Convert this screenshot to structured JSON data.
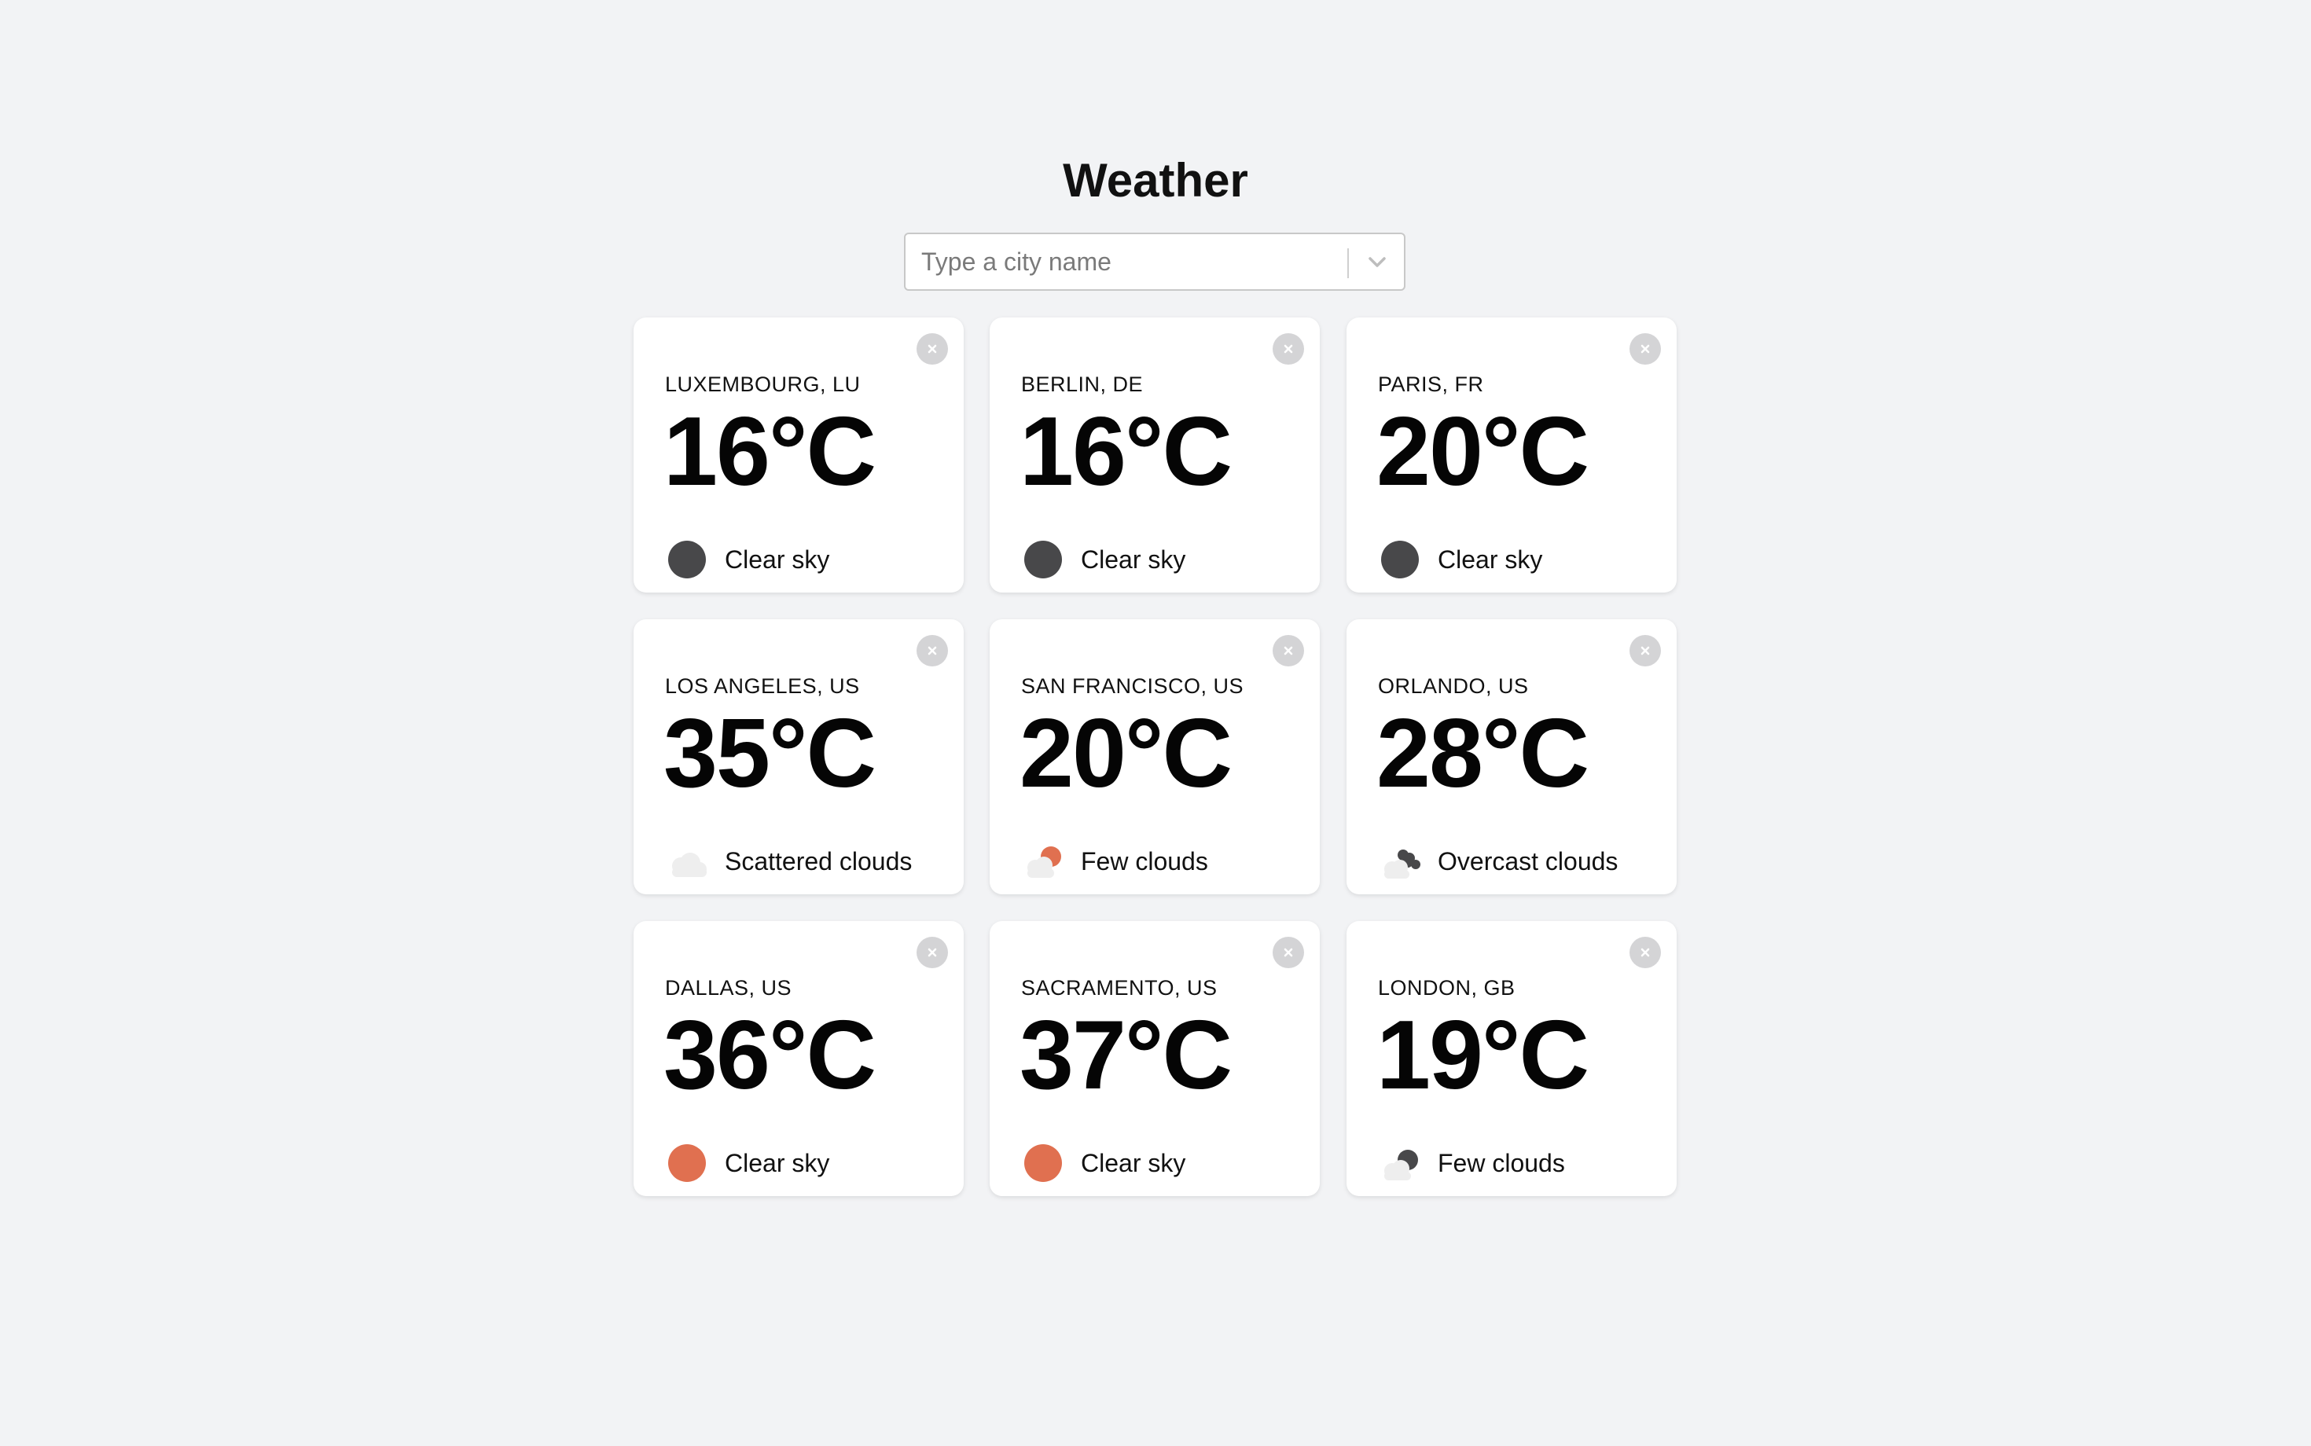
{
  "app": {
    "title": "Weather"
  },
  "search": {
    "placeholder": "Type a city name",
    "value": ""
  },
  "colors": {
    "background": "#f2f3f5",
    "card": "#ffffff",
    "dark_icon": "#48484a",
    "warm_icon": "#e07050",
    "cloud": "#eeeeee",
    "close_button": "#d4d4d6"
  },
  "cards": [
    {
      "city": "LUXEMBOURG, LU",
      "temp": "16°C",
      "condition": "Clear sky",
      "icon": "moon-icon"
    },
    {
      "city": "BERLIN, DE",
      "temp": "16°C",
      "condition": "Clear sky",
      "icon": "moon-icon"
    },
    {
      "city": "PARIS, FR",
      "temp": "20°C",
      "condition": "Clear sky",
      "icon": "moon-icon"
    },
    {
      "city": "LOS ANGELES, US",
      "temp": "35°C",
      "condition": "Scattered clouds",
      "icon": "cloud-icon"
    },
    {
      "city": "SAN FRANCISCO, US",
      "temp": "20°C",
      "condition": "Few clouds",
      "icon": "sun-behind-cloud-icon"
    },
    {
      "city": "ORLANDO, US",
      "temp": "28°C",
      "condition": "Overcast clouds",
      "icon": "overcast-clouds-icon"
    },
    {
      "city": "DALLAS, US",
      "temp": "36°C",
      "condition": "Clear sky",
      "icon": "sun-icon"
    },
    {
      "city": "SACRAMENTO, US",
      "temp": "37°C",
      "condition": "Clear sky",
      "icon": "sun-icon"
    },
    {
      "city": "LONDON, GB",
      "temp": "19°C",
      "condition": "Few clouds",
      "icon": "moon-behind-cloud-icon"
    }
  ]
}
